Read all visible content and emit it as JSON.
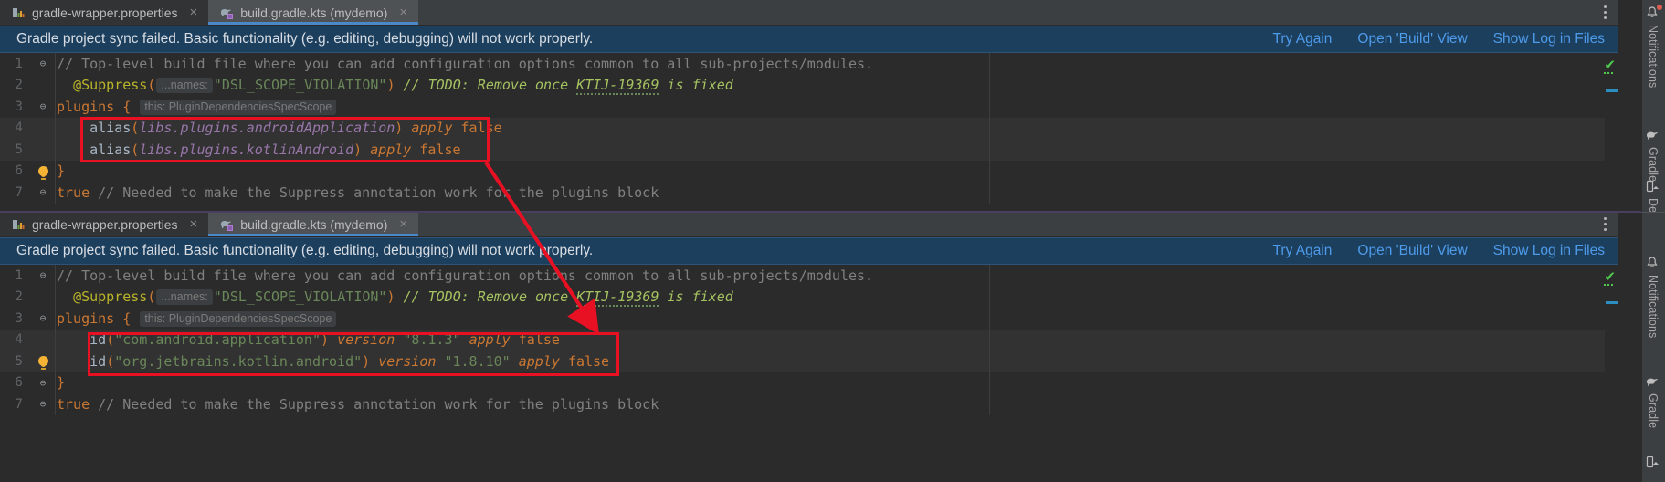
{
  "window": {
    "accent_blue": "#4a88c7",
    "banner_bg": "#1c3f5e",
    "link_color": "#4e9bea",
    "annotation_red": "#e81123"
  },
  "tabs": [
    {
      "label": "gradle-wrapper.properties",
      "icon": "gradle-properties-icon",
      "close": "×",
      "active": false
    },
    {
      "label": "build.gradle.kts (mydemo)",
      "icon": "gradle-kts-icon",
      "close": "×",
      "active": true
    }
  ],
  "tab_overflow_icon": "more-options-icon",
  "banner": {
    "message": "Gradle project sync failed. Basic functionality (e.g. editing, debugging) will not work properly.",
    "links": [
      {
        "label": "Try Again",
        "name": "try-again-link"
      },
      {
        "label": "Open 'Build' View",
        "name": "open-build-view-link"
      },
      {
        "label": "Show Log in Files",
        "name": "show-log-in-files-link"
      }
    ]
  },
  "editor_top": {
    "lines": [
      {
        "num": "1",
        "fold": "⊖",
        "bulb": false,
        "highlight": false,
        "tokens": [
          {
            "t": "cm",
            "v": "// Top-level build file where you can add configuration options common to all sub-projects/modules."
          }
        ]
      },
      {
        "num": "2",
        "fold": "",
        "bulb": false,
        "highlight": false,
        "tokens": [
          {
            "t": "plain",
            "v": "  "
          },
          {
            "t": "ann",
            "v": "@Suppress"
          },
          {
            "t": "paren",
            "v": "("
          },
          {
            "t": "chip",
            "v": "...names:"
          },
          {
            "t": "str",
            "v": "\"DSL_SCOPE_VIOLATION\""
          },
          {
            "t": "paren",
            "v": ")"
          },
          {
            "t": "cm",
            "v": " "
          },
          {
            "t": "todo",
            "v": "// TODO: Remove once "
          },
          {
            "t": "todo-u",
            "v": "KTIJ-19369"
          },
          {
            "t": "todo",
            "v": " is fixed"
          }
        ]
      },
      {
        "num": "3",
        "fold": "⊖",
        "bulb": false,
        "highlight": false,
        "tokens": [
          {
            "t": "kw",
            "v": "plugins"
          },
          {
            "t": "plain",
            "v": " "
          },
          {
            "t": "paren",
            "v": "{"
          },
          {
            "t": "plain",
            "v": " "
          },
          {
            "t": "chip",
            "v": "this: PluginDependenciesSpecScope"
          }
        ]
      },
      {
        "num": "4",
        "fold": "",
        "bulb": false,
        "highlight": true,
        "tokens": [
          {
            "t": "plain",
            "v": "    "
          },
          {
            "t": "fn",
            "v": "alias"
          },
          {
            "t": "paren",
            "v": "("
          },
          {
            "t": "prop",
            "v": "libs.plugins.androidApplication"
          },
          {
            "t": "paren",
            "v": ")"
          },
          {
            "t": "plain",
            "v": " "
          },
          {
            "t": "kwi",
            "v": "apply"
          },
          {
            "t": "plain",
            "v": " "
          },
          {
            "t": "kw",
            "v": "false"
          }
        ]
      },
      {
        "num": "5",
        "fold": "",
        "bulb": false,
        "highlight": true,
        "tokens": [
          {
            "t": "plain",
            "v": "    "
          },
          {
            "t": "fn",
            "v": "alias"
          },
          {
            "t": "paren",
            "v": "("
          },
          {
            "t": "prop",
            "v": "libs.plugins.kotlinAndroid"
          },
          {
            "t": "paren",
            "v": ")"
          },
          {
            "t": "plain",
            "v": " "
          },
          {
            "t": "kwi",
            "v": "apply"
          },
          {
            "t": "plain",
            "v": " "
          },
          {
            "t": "kw",
            "v": "false"
          }
        ]
      },
      {
        "num": "6",
        "fold": "⊖",
        "bulb": true,
        "highlight": false,
        "tokens": [
          {
            "t": "paren",
            "v": "}"
          }
        ]
      },
      {
        "num": "7",
        "fold": "⊖",
        "bulb": false,
        "highlight": false,
        "tokens": [
          {
            "t": "kw",
            "v": "true"
          },
          {
            "t": "plain",
            "v": " "
          },
          {
            "t": "cm",
            "v": "// Needed to make the Suppress annotation work for the plugins block"
          }
        ]
      }
    ]
  },
  "editor_bottom": {
    "lines": [
      {
        "num": "1",
        "fold": "⊖",
        "bulb": false,
        "highlight": false,
        "tokens": [
          {
            "t": "cm",
            "v": "// Top-level build file where you can add configuration options common to all sub-projects/modules."
          }
        ]
      },
      {
        "num": "2",
        "fold": "",
        "bulb": false,
        "highlight": false,
        "tokens": [
          {
            "t": "plain",
            "v": "  "
          },
          {
            "t": "ann",
            "v": "@Suppress"
          },
          {
            "t": "paren",
            "v": "("
          },
          {
            "t": "chip",
            "v": "...names:"
          },
          {
            "t": "str",
            "v": "\"DSL_SCOPE_VIOLATION\""
          },
          {
            "t": "paren",
            "v": ")"
          },
          {
            "t": "cm",
            "v": " "
          },
          {
            "t": "todo",
            "v": "// TODO: Remove once "
          },
          {
            "t": "todo-u",
            "v": "KTIJ-19369"
          },
          {
            "t": "todo",
            "v": " is fixed"
          }
        ]
      },
      {
        "num": "3",
        "fold": "⊖",
        "bulb": false,
        "highlight": false,
        "tokens": [
          {
            "t": "kw",
            "v": "plugins"
          },
          {
            "t": "plain",
            "v": " "
          },
          {
            "t": "paren",
            "v": "{"
          },
          {
            "t": "plain",
            "v": " "
          },
          {
            "t": "chip",
            "v": "this: PluginDependenciesSpecScope"
          }
        ]
      },
      {
        "num": "4",
        "fold": "",
        "bulb": false,
        "highlight": true,
        "tokens": [
          {
            "t": "plain",
            "v": "    "
          },
          {
            "t": "fn",
            "v": "id"
          },
          {
            "t": "paren",
            "v": "("
          },
          {
            "t": "str",
            "v": "\"com.android.application\""
          },
          {
            "t": "paren",
            "v": ")"
          },
          {
            "t": "plain",
            "v": " "
          },
          {
            "t": "kwi",
            "v": "version"
          },
          {
            "t": "plain",
            "v": " "
          },
          {
            "t": "str",
            "v": "\"8.1.3\""
          },
          {
            "t": "plain",
            "v": " "
          },
          {
            "t": "kwi",
            "v": "apply"
          },
          {
            "t": "plain",
            "v": " "
          },
          {
            "t": "kw",
            "v": "false"
          }
        ]
      },
      {
        "num": "5",
        "fold": "",
        "bulb": true,
        "highlight": true,
        "tokens": [
          {
            "t": "plain",
            "v": "    "
          },
          {
            "t": "fn",
            "v": "id"
          },
          {
            "t": "paren",
            "v": "("
          },
          {
            "t": "str",
            "v": "\"org.jetbrains.kotlin.android\""
          },
          {
            "t": "paren",
            "v": ")"
          },
          {
            "t": "plain",
            "v": " "
          },
          {
            "t": "kwi",
            "v": "version"
          },
          {
            "t": "plain",
            "v": " "
          },
          {
            "t": "str",
            "v": "\"1.8.10\""
          },
          {
            "t": "plain",
            "v": " "
          },
          {
            "t": "kwi",
            "v": "apply"
          },
          {
            "t": "plain",
            "v": " "
          },
          {
            "t": "kw",
            "v": "false"
          }
        ]
      },
      {
        "num": "6",
        "fold": "⊖",
        "bulb": false,
        "highlight": false,
        "tokens": [
          {
            "t": "paren",
            "v": "}"
          }
        ]
      },
      {
        "num": "7",
        "fold": "⊖",
        "bulb": false,
        "highlight": false,
        "tokens": [
          {
            "t": "kw",
            "v": "true"
          },
          {
            "t": "plain",
            "v": " "
          },
          {
            "t": "cm",
            "v": "// Needed to make the Suppress annotation work for the plugins block"
          }
        ]
      }
    ]
  },
  "toolstrip": [
    {
      "label": "Notifications",
      "icon": "bell-icon",
      "badge": true
    },
    {
      "label": "Gradle",
      "icon": "gradle-elephant-icon",
      "badge": false
    },
    {
      "label": "De",
      "icon": "device-manager-icon",
      "badge": false
    },
    {
      "label": "Notifications",
      "icon": "bell-icon",
      "badge": false
    },
    {
      "label": "Gradle",
      "icon": "gradle-elephant-icon",
      "badge": false
    },
    {
      "label": "",
      "icon": "device-manager-icon",
      "badge": false
    }
  ],
  "markers": {
    "inspection_status": "✔"
  }
}
